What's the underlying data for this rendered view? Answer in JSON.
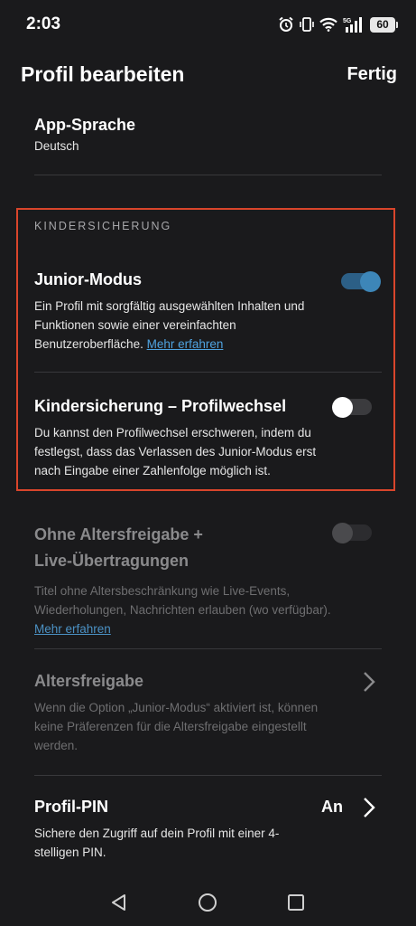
{
  "status_bar": {
    "time": "2:03",
    "battery": "60",
    "network": "5G"
  },
  "header": {
    "title": "Profil bearbeiten",
    "done_label": "Fertig"
  },
  "app_language": {
    "title": "App-Sprache",
    "value": "Deutsch"
  },
  "parental_section": {
    "label": "KINDERSICHERUNG",
    "junior_mode": {
      "title": "Junior-Modus",
      "description": "Ein Profil mit sorgfältig ausgewählten Inhalten und Funktionen sowie einer vereinfachten Benutzeroberfläche.",
      "link": "Mehr erfahren",
      "toggle_on": true
    },
    "profile_switch": {
      "title": "Kindersicherung – Profilwechsel",
      "description": "Du kannst den Profilwechsel erschweren, indem du festlegst, dass das Verlassen des Junior-Modus erst nach Eingabe einer Zahlenfolge möglich ist.",
      "toggle_on": false
    }
  },
  "unrated": {
    "title_line1": "Ohne Altersfreigabe +",
    "title_line2": "Live-Übertragungen",
    "description": "Titel ohne Altersbeschränkung wie Live-Events, Wiederholungen, Nachrichten erlauben (wo verfügbar).",
    "link": "Mehr erfahren",
    "toggle_on": false,
    "disabled": true
  },
  "age_rating": {
    "title": "Altersfreigabe",
    "description": "Wenn die Option „Junior-Modus“ aktiviert ist, können keine Präferenzen für die Altersfreigabe eingestellt werden."
  },
  "profile_pin": {
    "title": "Profil-PIN",
    "value": "An",
    "description": "Sichere den Zugriff auf dein Profil mit einer 4-stelligen PIN."
  },
  "colors": {
    "background": "#1a1a1c",
    "highlight_border": "#d9452b",
    "toggle_on": "#3d86b8",
    "link": "#4fa3e0"
  }
}
